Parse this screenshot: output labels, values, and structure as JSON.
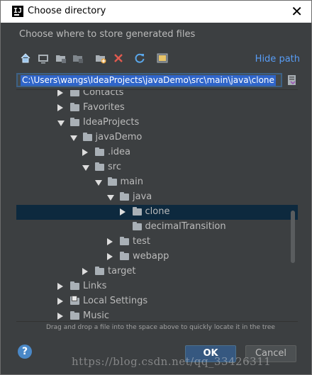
{
  "window": {
    "title": "Choose directory",
    "close_glyph": "✕"
  },
  "header": {
    "text": "Choose where to store generated files"
  },
  "toolbar": {
    "icons": [
      "home-icon",
      "desktop-icon",
      "project-folder-icon",
      "module-folder-icon",
      "new-folder-icon",
      "delete-icon",
      "refresh-icon",
      "show-hidden-icon"
    ],
    "hide_path_label": "Hide path"
  },
  "path": {
    "value": "C:\\Users\\wangs\\IdeaProjects\\javaDemo\\src\\main\\java\\clone"
  },
  "tree": {
    "items": [
      {
        "label": "Contacts",
        "depth": 0,
        "state": "collapsed",
        "special": false,
        "partial": true
      },
      {
        "label": "Favorites",
        "depth": 0,
        "state": "collapsed",
        "special": false
      },
      {
        "label": "IdeaProjects",
        "depth": 0,
        "state": "expanded",
        "special": false
      },
      {
        "label": "javaDemo",
        "depth": 1,
        "state": "expanded",
        "special": false
      },
      {
        "label": ".idea",
        "depth": 2,
        "state": "collapsed",
        "special": false
      },
      {
        "label": "src",
        "depth": 2,
        "state": "expanded",
        "special": false
      },
      {
        "label": "main",
        "depth": 3,
        "state": "expanded",
        "special": false
      },
      {
        "label": "java",
        "depth": 4,
        "state": "expanded",
        "special": false
      },
      {
        "label": "clone",
        "depth": 5,
        "state": "collapsed",
        "special": false,
        "selected": true
      },
      {
        "label": "decimalTransition",
        "depth": 5,
        "state": "none",
        "special": false
      },
      {
        "label": "test",
        "depth": 4,
        "state": "collapsed",
        "special": false
      },
      {
        "label": "webapp",
        "depth": 4,
        "state": "collapsed",
        "special": false
      },
      {
        "label": "target",
        "depth": 2,
        "state": "collapsed",
        "special": false
      },
      {
        "label": "Links",
        "depth": 0,
        "state": "collapsed",
        "special": false
      },
      {
        "label": "Local Settings",
        "depth": 0,
        "state": "collapsed",
        "special": true
      },
      {
        "label": "Music",
        "depth": 0,
        "state": "collapsed",
        "special": false
      }
    ]
  },
  "hint": "Drag and drop a file into the space above to quickly locate it in the tree",
  "buttons": {
    "help": "?",
    "ok": "OK",
    "cancel": "Cancel"
  },
  "watermark": "https://blog.csdn.net/qq_33426311"
}
